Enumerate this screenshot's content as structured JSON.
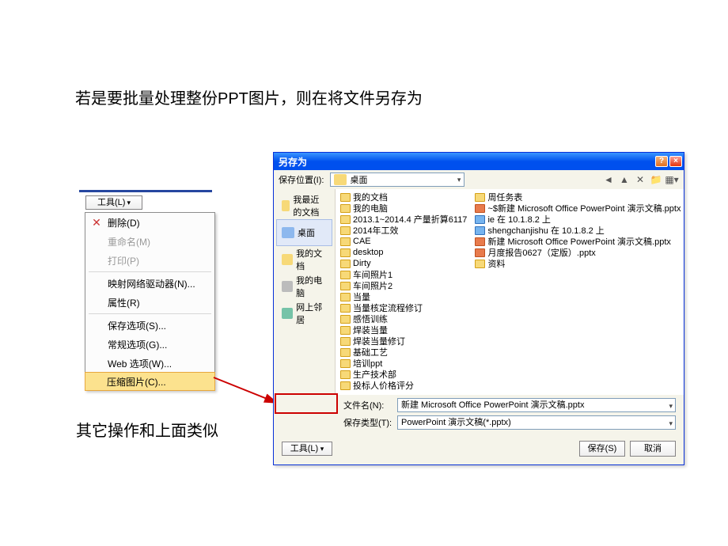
{
  "heading1": "若是要批量处理整份PPT图片，则在将文件另存为",
  "heading2": "其它操作和上面类似",
  "left_tools": {
    "button": "工具(L)",
    "items": [
      {
        "label": "删除(D)",
        "disabled": false,
        "icon": true
      },
      {
        "label": "重命名(M)",
        "disabled": true
      },
      {
        "label": "打印(P)",
        "disabled": true
      },
      {
        "label": "映射网络驱动器(N)..."
      },
      {
        "label": "属性(R)"
      },
      {
        "label": "保存选项(S)..."
      },
      {
        "label": "常规选项(G)..."
      },
      {
        "label": "Web 选项(W)..."
      },
      {
        "label": "压缩图片(C)...",
        "highlighted": true
      }
    ]
  },
  "dialog": {
    "title": "另存为",
    "location_label": "保存位置(I):",
    "location_value": "桌面",
    "places": [
      {
        "label": "我最近的文档",
        "kind": "folder"
      },
      {
        "label": "桌面",
        "kind": "desk",
        "selected": true
      },
      {
        "label": "我的文档",
        "kind": "folder"
      },
      {
        "label": "我的电脑",
        "kind": "computer"
      },
      {
        "label": "网上邻居",
        "kind": "net"
      }
    ],
    "files_col1": [
      {
        "icon": "fold",
        "name": "我的文档"
      },
      {
        "icon": "fold",
        "name": "我的电脑"
      },
      {
        "icon": "fold",
        "name": "2013.1~2014.4 产量折算6117"
      },
      {
        "icon": "fold",
        "name": "2014年工效"
      },
      {
        "icon": "fold",
        "name": "CAE"
      },
      {
        "icon": "fold",
        "name": "desktop"
      },
      {
        "icon": "fold",
        "name": "Dirty"
      },
      {
        "icon": "fold",
        "name": "车间照片1"
      },
      {
        "icon": "fold",
        "name": "车间照片2"
      },
      {
        "icon": "fold",
        "name": "当量"
      },
      {
        "icon": "fold",
        "name": "当量核定流程修订"
      },
      {
        "icon": "fold",
        "name": "感悟训练"
      },
      {
        "icon": "fold",
        "name": "焊装当量"
      },
      {
        "icon": "fold",
        "name": "焊装当量修订"
      },
      {
        "icon": "fold",
        "name": "基础工艺"
      },
      {
        "icon": "fold",
        "name": "培训ppt"
      },
      {
        "icon": "fold",
        "name": "生产技术部"
      },
      {
        "icon": "fold",
        "name": "投标人价格评分"
      }
    ],
    "files_col2": [
      {
        "icon": "fold",
        "name": "周任务表"
      },
      {
        "icon": "ppt",
        "name": "~$新建 Microsoft Office PowerPoint 演示文稿.pptx"
      },
      {
        "icon": "ie",
        "name": "ie 在 10.1.8.2 上"
      },
      {
        "icon": "ie",
        "name": "shengchanjishu 在 10.1.8.2 上"
      },
      {
        "icon": "ppt",
        "name": "新建 Microsoft Office PowerPoint 演示文稿.pptx"
      },
      {
        "icon": "ppt",
        "name": "月度报告0627（定版）.pptx"
      },
      {
        "icon": "fold",
        "name": "资料"
      }
    ],
    "filename_label": "文件名(N):",
    "filename_value": "新建 Microsoft Office PowerPoint 演示文稿.pptx",
    "filetype_label": "保存类型(T):",
    "filetype_value": "PowerPoint 演示文稿(*.pptx)",
    "tools_label": "工具(L)",
    "save_label": "保存(S)",
    "cancel_label": "取消"
  }
}
